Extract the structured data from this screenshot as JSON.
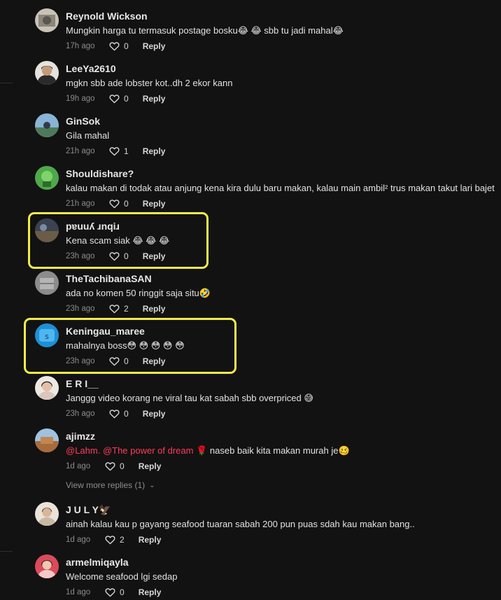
{
  "comments": [
    {
      "username": "Reynold Wickson",
      "text": "Mungkin harga tu termasuk postage bosku😂 😂 sbb tu jadi mahal😂",
      "time": "17h ago",
      "likes": "0",
      "reply": "Reply"
    },
    {
      "username": "LeeYa2610",
      "text": "mgkn sbb ade lobster kot..dh 2 ekor kann",
      "time": "19h ago",
      "likes": "0",
      "reply": "Reply"
    },
    {
      "username": "GinSok",
      "text": "Gila mahal",
      "time": "21h ago",
      "likes": "1",
      "reply": "Reply"
    },
    {
      "username": "Shouldishare?",
      "text": "kalau makan di todak atau anjung kena kira dulu baru makan, kalau main ambil² trus makan takut lari bajet",
      "time": "21h ago",
      "likes": "0",
      "reply": "Reply"
    },
    {
      "username": "pɐuuʎ ɹnqiɹ",
      "text": "Kena scam siak 😂 😂 😂",
      "time": "23h ago",
      "likes": "0",
      "reply": "Reply"
    },
    {
      "username": "TheTachibanaSAN",
      "text": "ada no komen 50 ringgit saja situ🤣",
      "time": "23h ago",
      "likes": "2",
      "reply": "Reply"
    },
    {
      "username": "Keningau_maree",
      "text": "mahalnya boss😳 😳 😳 😳 😳",
      "time": "23h ago",
      "likes": "0",
      "reply": "Reply"
    },
    {
      "username": "E R I__",
      "text": "Janggg video korang ne viral tau kat sabah sbb overpriced 😅",
      "time": "23h ago",
      "likes": "0",
      "reply": "Reply"
    },
    {
      "username": "ajimzz",
      "mention": "@Lahm. @The power of dream",
      "text": "🌹 naseb baik kita makan murah je🥴",
      "time": "1d ago",
      "likes": "0",
      "reply": "Reply"
    },
    {
      "username": "J U L Y🦅",
      "text": "ainah kalau kau p gayang seafood tuaran sabah 200 pun puas sdah kau makan bang..",
      "time": "1d ago",
      "likes": "2",
      "reply": "Reply"
    },
    {
      "username": "armelmiqayla",
      "text": "Welcome seafood lgi sedap",
      "time": "1d ago",
      "likes": "0",
      "reply": "Reply"
    }
  ],
  "view_more": {
    "label": "View more replies (1)"
  },
  "colors": {
    "background": "#121212",
    "highlight": "#f2ec4b",
    "mention": "#ff3b5c"
  },
  "icons": {
    "like": "heart-outline-icon",
    "expand": "chevron-down-icon"
  }
}
